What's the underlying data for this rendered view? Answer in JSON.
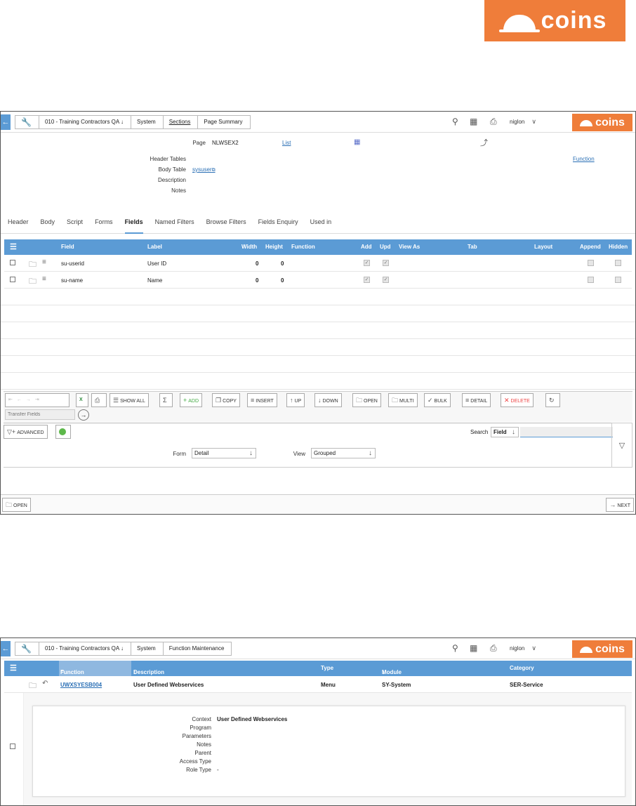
{
  "logo": {
    "text": "coins"
  },
  "screen1": {
    "breadcrumbs": [
      "010 - Training Contractors QA",
      "System",
      "Sections",
      "Page Summary"
    ],
    "user": "niglon",
    "page": {
      "label": "Page",
      "value": "NLWSEX2",
      "list_link": "List"
    },
    "function_link": "Function",
    "fields": [
      {
        "label": "Header Tables",
        "value": ""
      },
      {
        "label": "Body Table",
        "value": "sysuser"
      },
      {
        "label": "Description",
        "value": ""
      },
      {
        "label": "Notes",
        "value": ""
      }
    ],
    "tabs": [
      "Header",
      "Body",
      "Script",
      "Forms",
      "Fields",
      "Named Filters",
      "Browse Filters",
      "Fields Enquiry",
      "Used in"
    ],
    "active_tab": "Fields",
    "grid": {
      "columns": [
        "Field",
        "Label",
        "Width",
        "Height",
        "Function",
        "Add",
        "Upd",
        "View As",
        "Tab",
        "Layout",
        "Append",
        "Hidden"
      ],
      "rows": [
        {
          "field": "su-userid",
          "label": "User ID",
          "width": "0",
          "height": "0"
        },
        {
          "field": "su-name",
          "label": "Name",
          "width": "0",
          "height": "0"
        }
      ]
    },
    "toolbar": {
      "show_all": "SHOW ALL",
      "add": "ADD",
      "copy": "COPY",
      "insert": "INSERT",
      "up": "UP",
      "down": "DOWN",
      "open": "OPEN",
      "multi": "MULTI",
      "bulk": "BULK",
      "detail": "DETAIL",
      "delete": "DELETE",
      "transfer_placeholder": "Transfer Fields"
    },
    "advanced": "ADVANCED",
    "search": {
      "label": "Search",
      "field": "Field"
    },
    "form": {
      "label": "Form",
      "value": "Detail"
    },
    "view": {
      "label": "View",
      "value": "Grouped"
    },
    "open_button": "OPEN",
    "next_button": "NEXT"
  },
  "screen2": {
    "breadcrumbs": [
      "010 - Training Contractors QA",
      "System",
      "Function Maintenance"
    ],
    "user": "niglon",
    "columns": [
      "Function",
      "Description",
      "Type",
      "Module",
      "Category"
    ],
    "row": {
      "function": "UWXSYESB004",
      "description": "User Defined Webservices",
      "type": "Menu",
      "module": "SY-System",
      "category": "SER-Service"
    },
    "detail": [
      {
        "label": "Context",
        "value": "User Defined Webservices"
      },
      {
        "label": "Program",
        "value": ""
      },
      {
        "label": "Parameters",
        "value": ""
      },
      {
        "label": "Notes",
        "value": ""
      },
      {
        "label": "Parent",
        "value": ""
      },
      {
        "label": "Access Type",
        "value": ""
      },
      {
        "label": "Role Type",
        "value": "-"
      }
    ]
  }
}
